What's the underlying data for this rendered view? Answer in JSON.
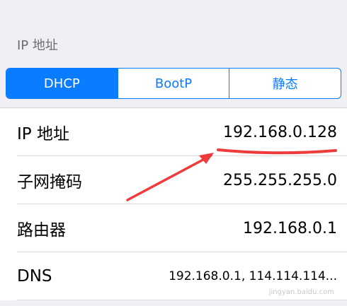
{
  "section": {
    "title": "IP 地址"
  },
  "segmented": {
    "options": [
      {
        "label": "DHCP",
        "active": true
      },
      {
        "label": "BootP",
        "active": false
      },
      {
        "label": "静态",
        "active": false
      }
    ]
  },
  "rows": [
    {
      "label": "IP 地址",
      "value": "192.168.0.128"
    },
    {
      "label": "子网掩码",
      "value": "255.255.255.0"
    },
    {
      "label": "路由器",
      "value": "192.168.0.1"
    },
    {
      "label": "DNS",
      "value": "192.168.0.1, 114.114.114..."
    }
  ],
  "watermark": "jingyan.baidu.com",
  "colors": {
    "accent": "#0a7cff",
    "annotation": "#ee3b3b",
    "background": "#efeff4"
  }
}
